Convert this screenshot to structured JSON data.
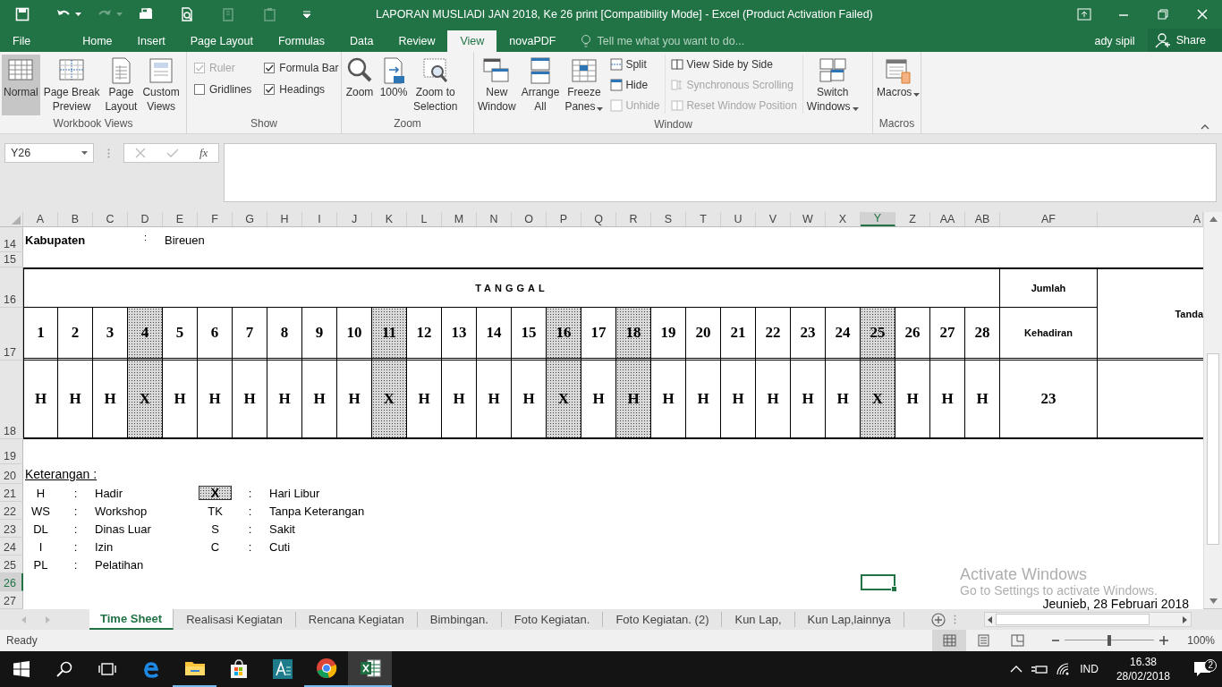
{
  "title_bar": {
    "quick_access": [
      {
        "kind": "save",
        "disabled": false
      },
      {
        "kind": "undo",
        "disabled": false
      },
      {
        "kind": "redo",
        "disabled": true
      },
      {
        "kind": "print",
        "disabled": false
      },
      {
        "kind": "preview",
        "disabled": false
      },
      {
        "kind": "page",
        "disabled": true
      },
      {
        "kind": "clipboard",
        "disabled": true
      }
    ],
    "title": "LAPORAN MUSLIADI JAN 2018, Ke 26 print [Compatibility Mode] - Excel (Product Activation Failed)"
  },
  "ribbon_tabs": [
    {
      "label": "File",
      "selected": false
    },
    {
      "label": "Home",
      "selected": false
    },
    {
      "label": "Insert",
      "selected": false
    },
    {
      "label": "Page Layout",
      "selected": false
    },
    {
      "label": "Formulas",
      "selected": false
    },
    {
      "label": "Data",
      "selected": false
    },
    {
      "label": "Review",
      "selected": false
    },
    {
      "label": "View",
      "selected": true
    },
    {
      "label": "novaPDF",
      "selected": false
    }
  ],
  "tell_me": {
    "placeholder": "Tell me what you want to do..."
  },
  "user": "ady sipil",
  "share": "Share",
  "ribbon": {
    "groups": [
      {
        "label": "Workbook Views",
        "items": [
          {
            "kind": "big",
            "label": "Normal",
            "selected": true,
            "dropdown": false
          },
          {
            "kind": "big",
            "label": "Page Break\nPreview",
            "selected": false,
            "dropdown": false
          },
          {
            "kind": "big",
            "label": "Page\nLayout",
            "selected": false,
            "dropdown": false
          },
          {
            "kind": "big",
            "label": "Custom\nViews",
            "selected": false,
            "dropdown": false
          }
        ]
      },
      {
        "label": "Show",
        "items": [
          {
            "kind": "check",
            "label": "Ruler",
            "checked": true,
            "disabled": true
          },
          {
            "kind": "check",
            "label": "Formula Bar",
            "checked": true,
            "disabled": false
          },
          {
            "kind": "check",
            "label": "Gridlines",
            "checked": false,
            "disabled": false
          },
          {
            "kind": "check",
            "label": "Headings",
            "checked": true,
            "disabled": false
          }
        ]
      },
      {
        "label": "Zoom",
        "items": [
          {
            "kind": "big",
            "label": "Zoom",
            "dropdown": false
          },
          {
            "kind": "big",
            "label": "100%",
            "dropdown": false
          },
          {
            "kind": "big",
            "label": "Zoom to\nSelection",
            "dropdown": false
          }
        ]
      },
      {
        "label": "Window",
        "items": [
          {
            "kind": "big",
            "label": "New\nWindow",
            "dropdown": false
          },
          {
            "kind": "big",
            "label": "Arrange\nAll",
            "dropdown": false
          },
          {
            "kind": "big",
            "label": "Freeze\nPanes",
            "dropdown": true
          },
          {
            "kind": "stack",
            "items": [
              {
                "label": "Split",
                "disabled": false
              },
              {
                "label": "Hide",
                "disabled": false
              },
              {
                "label": "Unhide",
                "disabled": true
              }
            ]
          },
          {
            "kind": "stack",
            "items": [
              {
                "label": "View Side by Side",
                "disabled": false
              },
              {
                "label": "Synchronous Scrolling",
                "disabled": true
              },
              {
                "label": "Reset Window Position",
                "disabled": true
              }
            ]
          },
          {
            "kind": "big",
            "label": "Switch\nWindows",
            "dropdown": true
          }
        ]
      },
      {
        "label": "Macros",
        "items": [
          {
            "kind": "big",
            "label": "Macros",
            "dropdown": true
          }
        ]
      }
    ]
  },
  "formula_bar": {
    "name_box": "Y26",
    "function_label": "fx"
  },
  "column_headers": [
    {
      "label": "A",
      "selected": false
    },
    {
      "label": "B",
      "selected": false
    },
    {
      "label": "C",
      "selected": false
    },
    {
      "label": "D",
      "selected": false
    },
    {
      "label": "E",
      "selected": false
    },
    {
      "label": "F",
      "selected": false
    },
    {
      "label": "G",
      "selected": false
    },
    {
      "label": "H",
      "selected": false
    },
    {
      "label": "I",
      "selected": false
    },
    {
      "label": "J",
      "selected": false
    },
    {
      "label": "K",
      "selected": false
    },
    {
      "label": "L",
      "selected": false
    },
    {
      "label": "M",
      "selected": false
    },
    {
      "label": "N",
      "selected": false
    },
    {
      "label": "O",
      "selected": false
    },
    {
      "label": "P",
      "selected": false
    },
    {
      "label": "Q",
      "selected": false
    },
    {
      "label": "R",
      "selected": false
    },
    {
      "label": "S",
      "selected": false
    },
    {
      "label": "T",
      "selected": false
    },
    {
      "label": "U",
      "selected": false
    },
    {
      "label": "V",
      "selected": false
    },
    {
      "label": "W",
      "selected": false
    },
    {
      "label": "X",
      "selected": false
    },
    {
      "label": "Y",
      "selected": true
    },
    {
      "label": "Z",
      "selected": false
    },
    {
      "label": "AA",
      "selected": false
    },
    {
      "label": "AB",
      "selected": false
    },
    {
      "label": "AF",
      "selected": false
    },
    {
      "label": "A",
      "selected": false
    }
  ],
  "row_headers": [
    {
      "label": "14",
      "selected": false
    },
    {
      "label": "15",
      "selected": false
    },
    {
      "label": "16",
      "selected": false
    },
    {
      "label": "17",
      "selected": false
    },
    {
      "label": "18",
      "selected": false
    },
    {
      "label": "19",
      "selected": false
    },
    {
      "label": "20",
      "selected": false
    },
    {
      "label": "21",
      "selected": false
    },
    {
      "label": "22",
      "selected": false
    },
    {
      "label": "23",
      "selected": false
    },
    {
      "label": "24",
      "selected": false
    },
    {
      "label": "25",
      "selected": false
    },
    {
      "label": "26",
      "selected": true
    },
    {
      "label": "27",
      "selected": false
    }
  ],
  "sheet": {
    "kabupaten": {
      "label": "Kabupaten",
      "separator": ":",
      "value": "Bireuen"
    },
    "attendance": {
      "header": "TANGGAL",
      "total_header": "Jumlah",
      "total_subheader": "Kehadiran",
      "signature_header": "Tanda",
      "total": "23",
      "days": [
        {
          "day": "1",
          "mark": "H",
          "shaded": false
        },
        {
          "day": "2",
          "mark": "H",
          "shaded": false
        },
        {
          "day": "3",
          "mark": "H",
          "shaded": false
        },
        {
          "day": "4",
          "mark": "X",
          "shaded": true
        },
        {
          "day": "5",
          "mark": "H",
          "shaded": false
        },
        {
          "day": "6",
          "mark": "H",
          "shaded": false
        },
        {
          "day": "7",
          "mark": "H",
          "shaded": false
        },
        {
          "day": "8",
          "mark": "H",
          "shaded": false
        },
        {
          "day": "9",
          "mark": "H",
          "shaded": false
        },
        {
          "day": "10",
          "mark": "H",
          "shaded": false
        },
        {
          "day": "11",
          "mark": "X",
          "shaded": true
        },
        {
          "day": "12",
          "mark": "H",
          "shaded": false
        },
        {
          "day": "13",
          "mark": "H",
          "shaded": false
        },
        {
          "day": "14",
          "mark": "H",
          "shaded": false
        },
        {
          "day": "15",
          "mark": "H",
          "shaded": false
        },
        {
          "day": "16",
          "mark": "X",
          "shaded": true
        },
        {
          "day": "17",
          "mark": "H",
          "shaded": false
        },
        {
          "day": "18",
          "mark": "H",
          "shaded": true
        },
        {
          "day": "19",
          "mark": "H",
          "shaded": false
        },
        {
          "day": "20",
          "mark": "H",
          "shaded": false
        },
        {
          "day": "21",
          "mark": "H",
          "shaded": false
        },
        {
          "day": "22",
          "mark": "H",
          "shaded": false
        },
        {
          "day": "23",
          "mark": "H",
          "shaded": false
        },
        {
          "day": "24",
          "mark": "H",
          "shaded": false
        },
        {
          "day": "25",
          "mark": "X",
          "shaded": true
        },
        {
          "day": "26",
          "mark": "H",
          "shaded": false
        },
        {
          "day": "27",
          "mark": "H",
          "shaded": false
        },
        {
          "day": "28",
          "mark": "H",
          "shaded": false
        }
      ]
    },
    "legend": {
      "title": "Keterangan :",
      "left": [
        {
          "code": "H",
          "separator": ":",
          "label": "Hadir"
        },
        {
          "code": "WS",
          "separator": ":",
          "label": "Workshop"
        },
        {
          "code": "DL",
          "separator": ":",
          "label": "Dinas Luar"
        },
        {
          "code": "I",
          "separator": ":",
          "label": "Izin"
        },
        {
          "code": "PL",
          "separator": ":",
          "label": "Pelatihan"
        }
      ],
      "right": [
        {
          "code": "X",
          "separator": ":",
          "label": "Hari Libur",
          "shaded": true
        },
        {
          "code": "TK",
          "separator": ":",
          "label": "Tanpa Keterangan",
          "shaded": false
        },
        {
          "code": "S",
          "separator": ":",
          "label": "Sakit",
          "shaded": false
        },
        {
          "code": "C",
          "separator": ":",
          "label": "Cuti",
          "shaded": false
        }
      ]
    },
    "place_date": "Jeunieb, 28 Februari 2018"
  },
  "sheet_tabs": [
    {
      "label": "Time Sheet",
      "selected": true
    },
    {
      "label": "Realisasi Kegiatan",
      "selected": false
    },
    {
      "label": "Rencana Kegiatan",
      "selected": false
    },
    {
      "label": "Bimbingan.",
      "selected": false
    },
    {
      "label": "Foto Kegiatan.",
      "selected": false
    },
    {
      "label": "Foto Kegiatan. (2)",
      "selected": false
    },
    {
      "label": "Kun Lap,",
      "selected": false
    },
    {
      "label": "Kun Lap,lainnya",
      "selected": false
    }
  ],
  "status_bar": {
    "status": "Ready",
    "view_buttons": [
      {
        "selected": true
      },
      {
        "selected": false
      },
      {
        "selected": false
      }
    ],
    "zoom_slider": {
      "level": 0.5
    },
    "zoom": "100%"
  },
  "activation_notice": {
    "title": "Activate Windows",
    "subtitle": "Go to Settings to activate Windows."
  },
  "taskbar": {
    "apps": [
      {
        "kind": "edge",
        "running": false,
        "active": false
      },
      {
        "kind": "folder",
        "running": true,
        "active": false
      },
      {
        "kind": "store",
        "running": false,
        "active": false
      },
      {
        "kind": "editor",
        "running": false,
        "active": false
      },
      {
        "kind": "chrome",
        "running": true,
        "active": false
      },
      {
        "kind": "excel",
        "running": true,
        "active": true
      }
    ],
    "language": "IND",
    "time": "16.38",
    "date": "28/02/2018",
    "notifications": "2"
  }
}
